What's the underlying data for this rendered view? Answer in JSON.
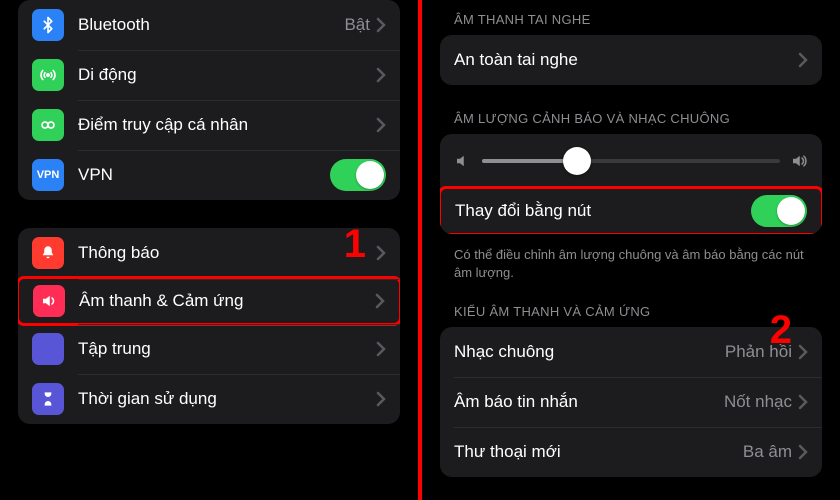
{
  "left": {
    "group1": {
      "bluetooth": {
        "label": "Bluetooth",
        "value": "Bật"
      },
      "cellular": {
        "label": "Di động"
      },
      "hotspot": {
        "label": "Điểm truy cập cá nhân"
      },
      "vpn": {
        "label": "VPN",
        "badge": "VPN",
        "on": true
      }
    },
    "group2": {
      "notifications": {
        "label": "Thông báo"
      },
      "sounds": {
        "label": "Âm thanh & Cảm ứng"
      },
      "focus": {
        "label": "Tập trung"
      },
      "screentime": {
        "label": "Thời gian sử dụng"
      }
    },
    "marker": "1"
  },
  "right": {
    "headphone_header": "ÂM THANH TAI NGHE",
    "headphone_safety": {
      "label": "An toàn tai nghe"
    },
    "ringer_header": "ÂM LƯỢNG CẢNH BÁO VÀ NHẠC CHUÔNG",
    "ringer_value_pct": 32,
    "change_with_buttons": {
      "label": "Thay đổi bằng nút",
      "on": true
    },
    "footer": "Có thể điều chỉnh âm lượng chuông và âm báo bằng các nút âm lượng.",
    "patterns_header": "KIỂU ÂM THANH VÀ CẢM ỨNG",
    "ringtone": {
      "label": "Nhạc chuông",
      "value": "Phản hồi"
    },
    "text_tone": {
      "label": "Âm báo tin nhắn",
      "value": "Nốt nhạc"
    },
    "voicemail": {
      "label": "Thư thoại mới",
      "value": "Ba âm"
    },
    "marker": "2"
  },
  "colors": {
    "bluetooth": "#2b82f6",
    "cellular": "#30d158",
    "hotspot": "#30d158",
    "notifications": "#ff3b30",
    "sounds": "#ff2d55",
    "focus": "#5856d6",
    "screentime": "#5856d6"
  }
}
